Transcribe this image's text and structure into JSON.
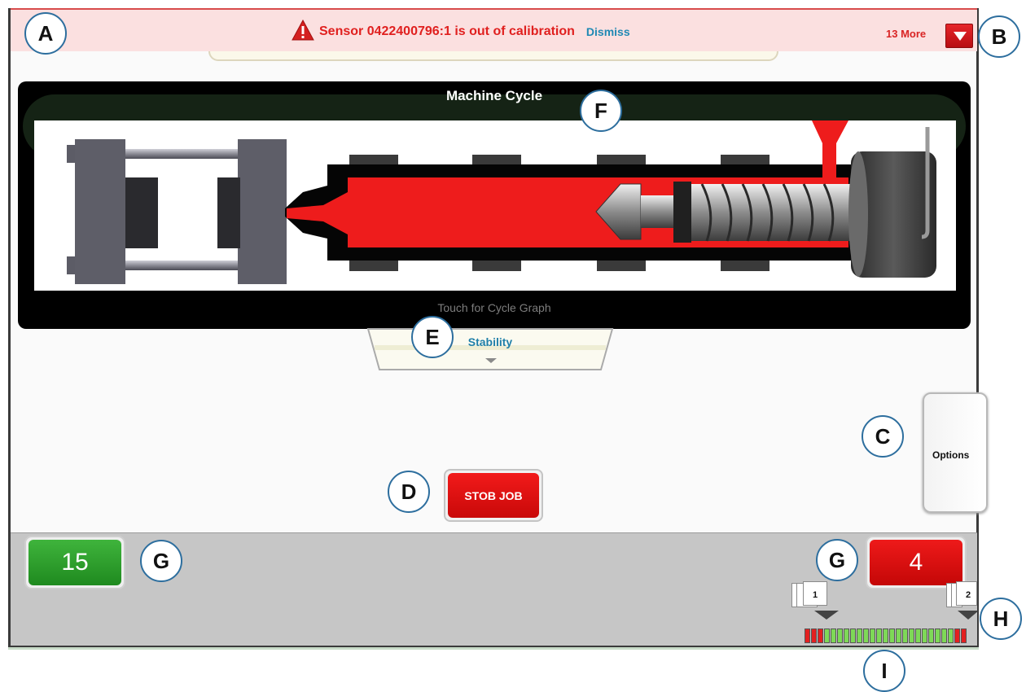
{
  "alert": {
    "message": "Sensor 0422400796:1 is out of calibration",
    "dismiss_label": "Dismiss",
    "more_label": "13 More",
    "icon": "warning-triangle-icon",
    "color": "#e0201f"
  },
  "cycle": {
    "title": "Machine Cycle",
    "hint": "Touch for Cycle Graph"
  },
  "stability_tab": {
    "label": "Stability"
  },
  "options": {
    "label": "Options"
  },
  "stop_job": {
    "label": "STOB JOB"
  },
  "counters": {
    "good": {
      "value": "15",
      "color": "#2a9c2a"
    },
    "bad": {
      "value": "4",
      "color": "#d91111"
    }
  },
  "stacks": {
    "left": "1",
    "right": "2"
  },
  "signal_bar": {
    "segments": [
      "red",
      "red",
      "red",
      "green",
      "green",
      "green",
      "green",
      "green",
      "green",
      "green",
      "green",
      "green",
      "green",
      "green",
      "green",
      "green",
      "green",
      "green",
      "green",
      "green",
      "green",
      "green",
      "green",
      "red",
      "red"
    ],
    "colors": {
      "red": "#e32020",
      "green": "#7ed957"
    }
  },
  "callouts": {
    "a": "A",
    "b": "B",
    "c": "C",
    "d": "D",
    "e": "E",
    "f": "F",
    "g1": "G",
    "g2": "G",
    "h": "H",
    "i": "I"
  }
}
